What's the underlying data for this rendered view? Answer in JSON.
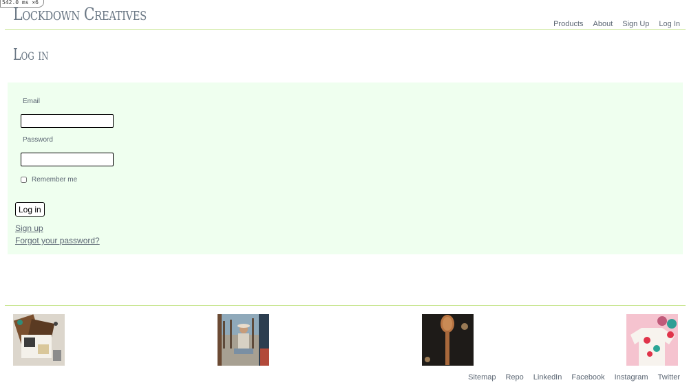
{
  "debug": {
    "timer": "542.0 ms ×6"
  },
  "header": {
    "brand": "Lockdown Creatives",
    "nav": [
      "Products",
      "About",
      "Sign Up",
      "Log In"
    ]
  },
  "page": {
    "title": "Log in"
  },
  "login_form": {
    "email_label": "Email",
    "email_value": "",
    "password_label": "Password",
    "password_value": "",
    "remember_label": "Remember me",
    "remember_checked": false,
    "submit_label": "Log in",
    "signup_link": "Sign up",
    "forgot_link": "Forgot your password?"
  },
  "gallery": {
    "images": [
      {
        "subject": "craft-supplies-flatlay",
        "icon": "photo-icon"
      },
      {
        "subject": "person-sitting-on-beach",
        "icon": "photo-icon"
      },
      {
        "subject": "wooden-spoon",
        "icon": "photo-icon"
      },
      {
        "subject": "painted-tshirt-with-paint-pots",
        "icon": "photo-icon"
      }
    ]
  },
  "footer": {
    "links": [
      "Sitemap",
      "Repo",
      "LinkedIn",
      "Facebook",
      "Instagram",
      "Twitter"
    ]
  },
  "colors": {
    "accent_rule": "#c7e58f",
    "panel_background": "#efffef",
    "text": "#5b6673"
  }
}
